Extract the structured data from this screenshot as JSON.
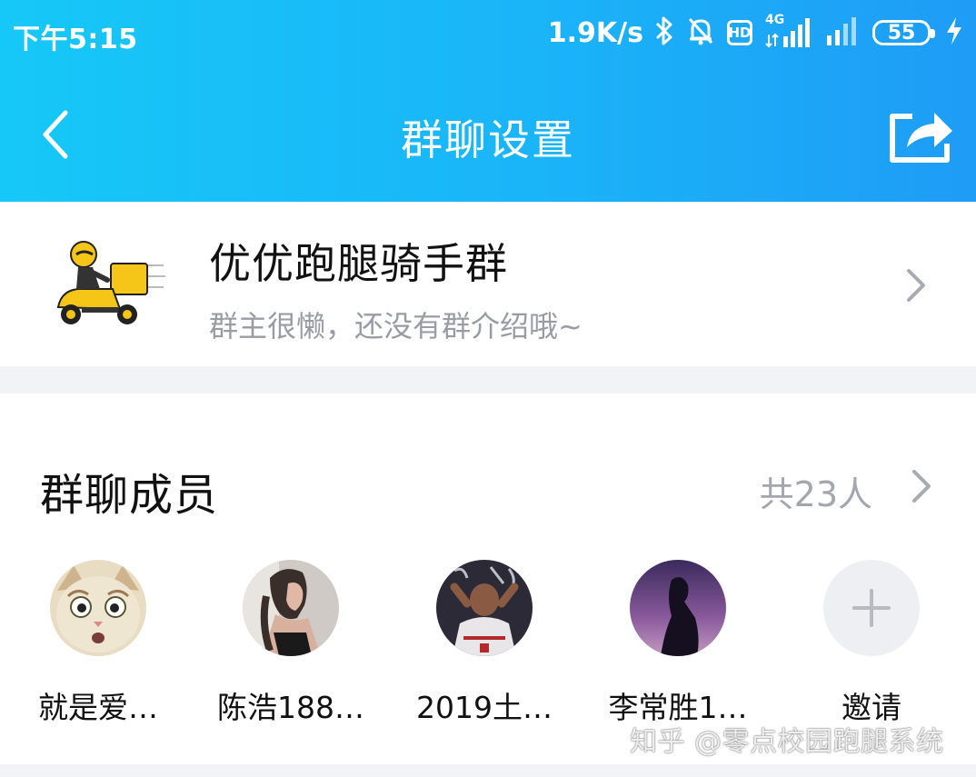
{
  "status_bar": {
    "time": "下午5:15",
    "net_speed": "1.9K/s",
    "hd_label": "HD",
    "network_type": "4G",
    "battery": "55"
  },
  "nav": {
    "title": "群聊设置"
  },
  "group": {
    "name": "优优跑腿骑手群",
    "description": "群主很懒，还没有群介绍哦~"
  },
  "members": {
    "title": "群聊成员",
    "count_label": "共23人",
    "list": [
      {
        "name": "就是爱…",
        "avatar": "cat-avatar"
      },
      {
        "name": "陈浩188…",
        "avatar": "girl-avatar"
      },
      {
        "name": "2019土…",
        "avatar": "iverson-avatar"
      },
      {
        "name": "李常胜1…",
        "avatar": "silhouette-avatar"
      }
    ],
    "invite_label": "邀请"
  },
  "watermark": "知乎 @零点校园跑腿系统",
  "colors": {
    "header_start": "#16c8f7",
    "header_end": "#1e9cf6",
    "text_primary": "#111111",
    "text_secondary": "#9a9ca3",
    "background": "#f2f3f7"
  }
}
